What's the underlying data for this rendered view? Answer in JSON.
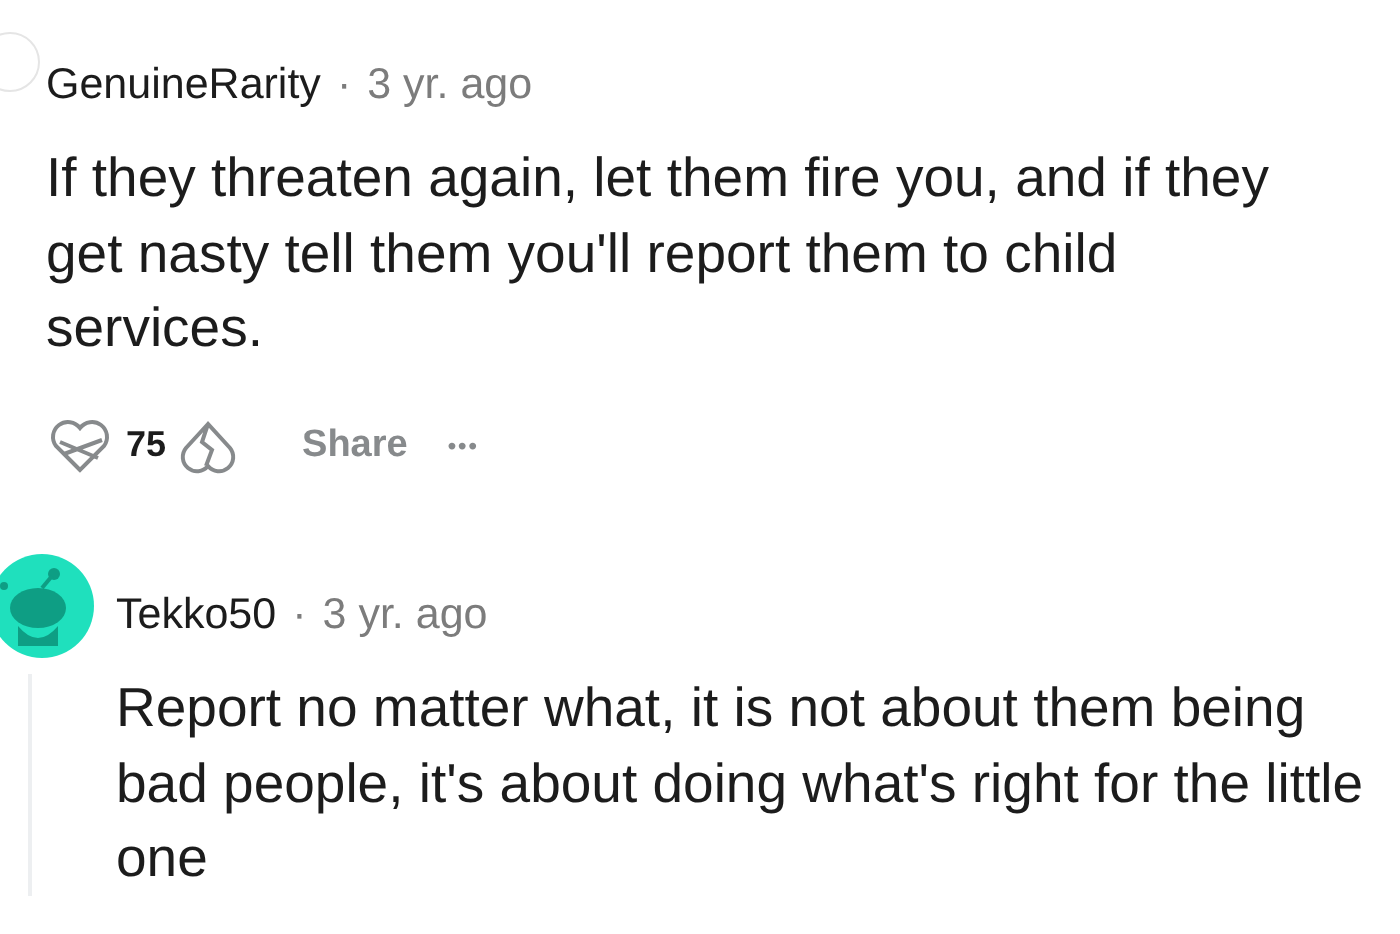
{
  "comments": [
    {
      "author": "GenuineRarity",
      "separator": "·",
      "time": "3 yr. ago",
      "kind": "partial",
      "body": "If they threaten again, let them fire you, and if they get nasty tell them you'll report them to child services.",
      "actions": {
        "votes": "75",
        "share": "Share",
        "more": "•••"
      }
    },
    {
      "author": "Tekko50",
      "separator": "·",
      "time": "3 yr. ago",
      "kind": "snoo",
      "body": "Report no matter what, it is not about them being bad people, it's about doing what's right for the little one"
    }
  ]
}
